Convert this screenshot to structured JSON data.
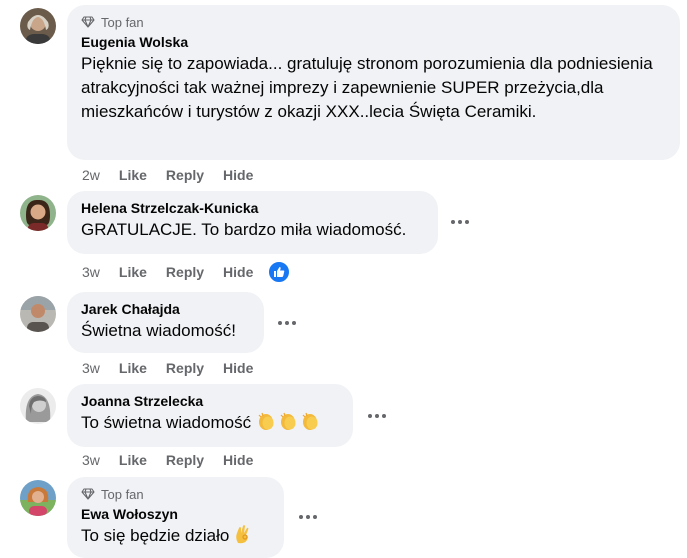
{
  "comments": [
    {
      "badge": "Top fan",
      "author": "Eugenia Wolska",
      "text": "Pięknie się to zapowiada... gratuluję stronom porozumienia dla podniesienia atrakcyjności tak ważnej imprezy i zapewnienie SUPER przeżycia,dla mieszkańców i turystów z okazji XXX..lecia Święta Ceramiki.",
      "time": "2w",
      "like": "Like",
      "reply": "Reply",
      "hide": "Hide"
    },
    {
      "author": "Helena Strzelczak-Kunicka",
      "text": "GRATULACJE. To bardzo miła wiadomość.",
      "time": "3w",
      "like": "Like",
      "reply": "Reply",
      "hide": "Hide",
      "reaction": "like-reaction-icon"
    },
    {
      "author": "Jarek Chałajda",
      "text": "Świetna wiadomość!",
      "time": "3w",
      "like": "Like",
      "reply": "Reply",
      "hide": "Hide"
    },
    {
      "author": "Joanna Strzelecka",
      "text": "To świetna wiadomość",
      "emoji": "clapping-hands-emoji x3",
      "time": "3w",
      "like": "Like",
      "reply": "Reply",
      "hide": "Hide"
    },
    {
      "badge": "Top fan",
      "author": "Ewa Wołoszyn",
      "text": "To się będzie działo",
      "emoji": "ok-hand-emoji"
    }
  ],
  "colors": {
    "bubble": "#f0f2f5",
    "secondary_text": "#65676b",
    "like_blue": "#1877f2"
  }
}
